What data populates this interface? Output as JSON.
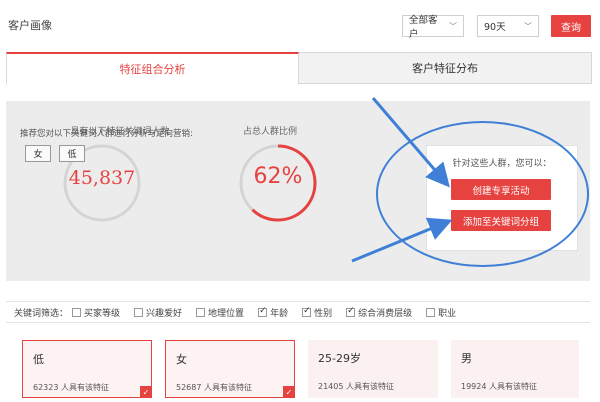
{
  "header": {
    "title": "客户画像",
    "filter_customer": "全部客户",
    "filter_days": "90天",
    "query_label": "查询"
  },
  "tabs": [
    {
      "label": "特征组合分析",
      "active": true
    },
    {
      "label": "客户特征分布",
      "active": false
    }
  ],
  "stats": {
    "count_label": "具有以下特征关键词人数",
    "count_value": "45,837",
    "ratio_label": "占总人群比例",
    "ratio_value": "62%",
    "ratio_fraction": 0.62
  },
  "suggest": {
    "text": "推荐您对以下关键词人群进行分析与定向营销:",
    "chips": [
      "女",
      "低"
    ]
  },
  "side_card": {
    "title": "针对这些人群，您可以：",
    "create_label": "创建专享活动",
    "add_label": "添加至关键词分组"
  },
  "keyword_bar": {
    "label": "关键词筛选：",
    "items": [
      {
        "label": "买家等级",
        "checked": false
      },
      {
        "label": "兴趣爱好",
        "checked": false
      },
      {
        "label": "地理位置",
        "checked": false
      },
      {
        "label": "年龄",
        "checked": true
      },
      {
        "label": "性别",
        "checked": true
      },
      {
        "label": "综合消费层级",
        "checked": true
      },
      {
        "label": "职业",
        "checked": false
      }
    ]
  },
  "cards": [
    {
      "title": "低",
      "sub": "62323 人具有该特征",
      "selected": true
    },
    {
      "title": "女",
      "sub": "52687 人具有该特征",
      "selected": true
    },
    {
      "title": "25-29岁",
      "sub": "21405 人具有该特征",
      "selected": false
    },
    {
      "title": "男",
      "sub": "19924 人具有该特征",
      "selected": false
    }
  ],
  "colors": {
    "accent": "#e64240",
    "annotation_blue": "#3f7fd6"
  }
}
